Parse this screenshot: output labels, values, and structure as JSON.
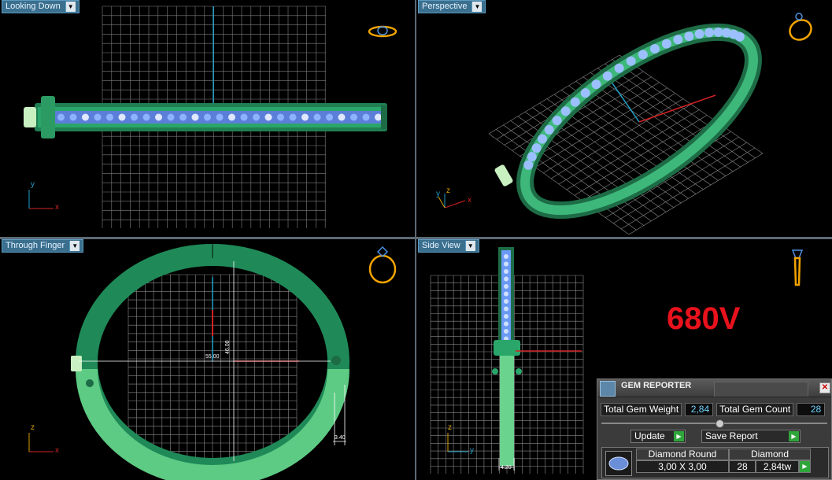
{
  "viewports": {
    "top_left": {
      "title": "Looking Down"
    },
    "top_right": {
      "title": "Perspective"
    },
    "bottom_left": {
      "title": "Through Finger"
    },
    "bottom_right": {
      "title": "Side View"
    }
  },
  "axes": {
    "x": "x",
    "y": "y",
    "z": "z"
  },
  "dimensions": {
    "width": "55.00",
    "height": "46.00",
    "band_thickness": "3.40",
    "side_width": "4.20"
  },
  "model_label": "680V",
  "gem_reporter": {
    "title": "GEM REPORTER",
    "close": "✕",
    "total_weight_label": "Total Gem Weight",
    "total_weight_value": "2,84",
    "total_count_label": "Total Gem Count",
    "total_count_value": "28",
    "update_label": "Update",
    "save_report_label": "Save Report",
    "gem": {
      "name": "Diamond Round",
      "size": "3,00 X 3,00",
      "material": "Diamond",
      "count": "28",
      "weight": "2,84tw"
    }
  },
  "colors": {
    "viewport_bg": "#000000",
    "grid": "#8a8a8a",
    "ring_green": "#2c9a63",
    "ring_light_green": "#6ad38e",
    "gem_blue": "#7fa8ff",
    "accent_red": "#e8121c",
    "axis_x": "#d22222",
    "axis_y": "#1fa0c8"
  }
}
